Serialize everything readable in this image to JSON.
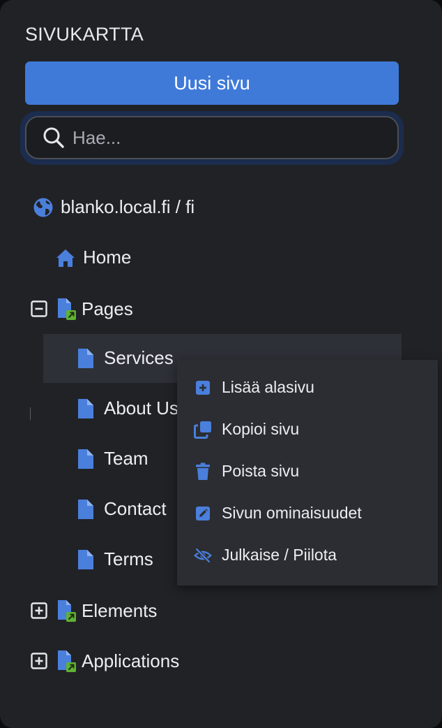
{
  "sidebar": {
    "title": "SIVUKARTTA",
    "new_page_label": "Uusi sivu",
    "search": {
      "placeholder": "Hae...",
      "value": ""
    }
  },
  "tree": {
    "site": "blanko.local.fi / fi",
    "home": "Home",
    "pages": {
      "label": "Pages",
      "state": "expanded",
      "children": [
        "Services",
        "About Us",
        "Team",
        "Contact",
        "Terms"
      ],
      "selected": "Services"
    },
    "elements": {
      "label": "Elements",
      "state": "collapsed"
    },
    "applications": {
      "label": "Applications",
      "state": "collapsed"
    }
  },
  "context_menu": {
    "items": [
      {
        "label": "Lisää alasivu",
        "icon": "add-square-icon"
      },
      {
        "label": "Kopioi sivu",
        "icon": "copy-icon"
      },
      {
        "label": "Poista sivu",
        "icon": "trash-icon"
      },
      {
        "label": "Sivun ominaisuudet",
        "icon": "edit-square-icon"
      },
      {
        "label": "Julkaise / Piilota",
        "icon": "eye-slash-icon"
      }
    ]
  },
  "colors": {
    "accent": "#3f7ad9",
    "icon_blue": "#4a7fdc",
    "link_badge_green": "#5fb233",
    "panel_bg": "#212226",
    "selected_bg": "#2d3036",
    "menu_bg": "#2b2d32"
  }
}
